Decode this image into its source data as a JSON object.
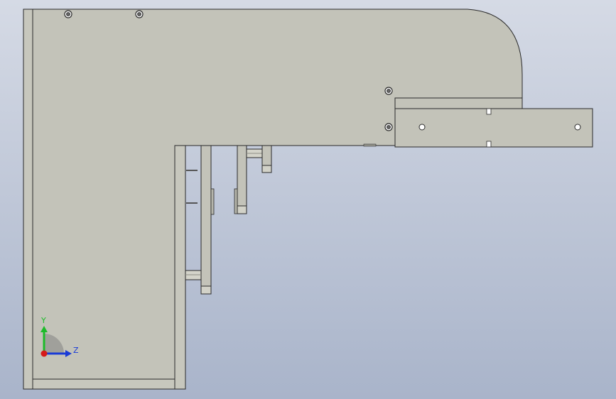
{
  "view": {
    "background_top": "#d6dbe6",
    "background_bottom": "#a9b5cb",
    "part_color": "#c3c3b9",
    "edge_color": "#2a2a2a"
  },
  "triad": {
    "y_label": "Y",
    "z_label": "Z",
    "y_color": "#1dbb2a",
    "z_color": "#1a3bd6",
    "x_color": "#d51a1a"
  }
}
